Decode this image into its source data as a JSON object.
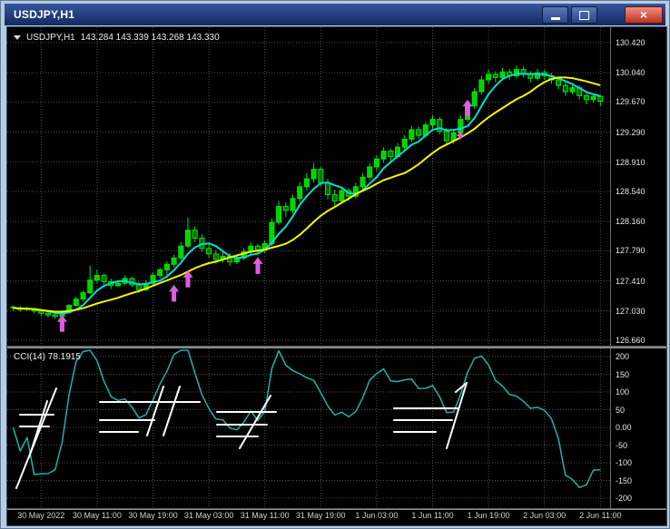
{
  "window": {
    "title": "USDJPY,H1"
  },
  "icons": {
    "close": "×"
  },
  "chart": {
    "symbol": "USDJPY,H1",
    "quote": "143.284 143.339 143.268 143.330"
  },
  "indicator": {
    "label": "CCI(14) 78.1915"
  },
  "axes": {
    "price_ticks": [
      "130.420",
      "130.040",
      "129.670",
      "129.290",
      "128.910",
      "128.540",
      "128.160",
      "127.790",
      "127.410",
      "127.030",
      "126.660"
    ],
    "cci_ticks": [
      "200",
      "150",
      "100",
      "50",
      "0.00",
      "-50",
      "-100",
      "-150",
      "-200"
    ],
    "time_ticks": [
      {
        "label": "30 May 2022",
        "bar": 4
      },
      {
        "label": "30 May 11:00",
        "bar": 12
      },
      {
        "label": "30 May 19:00",
        "bar": 20
      },
      {
        "label": "31 May 03:00",
        "bar": 28
      },
      {
        "label": "31 May 11:00",
        "bar": 36
      },
      {
        "label": "31 May 19:00",
        "bar": 44
      },
      {
        "label": "1 Jun 03:00",
        "bar": 52
      },
      {
        "label": "1 Jun 11:00",
        "bar": 60
      },
      {
        "label": "1 Jun 19:00",
        "bar": 68
      },
      {
        "label": "2 Jun 03:00",
        "bar": 76
      },
      {
        "label": "2 Jun 11:00",
        "bar": 84
      }
    ]
  },
  "colors": {
    "background": "#000000",
    "grid": "#4d4d4d",
    "candle_outline": "#00e600",
    "bull": "#00d400",
    "bear": "#007000",
    "axis_text": "#e6e6e6"
  },
  "chart_data": {
    "type": "candlestick",
    "symbol": "USDJPY",
    "timeframe": "H1",
    "price_range": [
      126.66,
      130.42
    ],
    "candles": [
      [
        127.08,
        127.1,
        127.03,
        127.07
      ],
      [
        127.07,
        127.09,
        127.02,
        127.05
      ],
      [
        127.05,
        127.08,
        127.03,
        127.06
      ],
      [
        127.06,
        127.07,
        127.0,
        127.03
      ],
      [
        127.03,
        127.05,
        126.97,
        127.0
      ],
      [
        127.0,
        127.02,
        126.95,
        126.98
      ],
      [
        126.98,
        127.0,
        126.93,
        126.96
      ],
      [
        126.96,
        127.04,
        126.94,
        127.02
      ],
      [
        127.02,
        127.12,
        127.0,
        127.1
      ],
      [
        127.1,
        127.21,
        127.08,
        127.18
      ],
      [
        127.18,
        127.29,
        127.15,
        127.26
      ],
      [
        127.26,
        127.6,
        127.24,
        127.42
      ],
      [
        127.42,
        127.55,
        127.38,
        127.48
      ],
      [
        127.48,
        127.5,
        127.36,
        127.4
      ],
      [
        127.4,
        127.44,
        127.31,
        127.35
      ],
      [
        127.35,
        127.42,
        127.33,
        127.38
      ],
      [
        127.38,
        127.48,
        127.35,
        127.44
      ],
      [
        127.44,
        127.46,
        127.33,
        127.36
      ],
      [
        127.36,
        127.4,
        127.26,
        127.3
      ],
      [
        127.3,
        127.42,
        127.28,
        127.38
      ],
      [
        127.38,
        127.52,
        127.36,
        127.48
      ],
      [
        127.48,
        127.58,
        127.44,
        127.55
      ],
      [
        127.55,
        127.66,
        127.45,
        127.62
      ],
      [
        127.62,
        127.74,
        127.58,
        127.7
      ],
      [
        127.7,
        127.9,
        127.66,
        127.85
      ],
      [
        127.85,
        128.21,
        127.82,
        128.05
      ],
      [
        128.05,
        128.1,
        127.9,
        127.95
      ],
      [
        127.95,
        128.0,
        127.78,
        127.82
      ],
      [
        127.82,
        127.88,
        127.7,
        127.75
      ],
      [
        127.75,
        127.8,
        127.63,
        127.68
      ],
      [
        127.68,
        127.78,
        127.64,
        127.72
      ],
      [
        127.72,
        127.76,
        127.6,
        127.65
      ],
      [
        127.65,
        127.74,
        127.62,
        127.7
      ],
      [
        127.7,
        127.82,
        127.67,
        127.78
      ],
      [
        127.78,
        127.9,
        127.74,
        127.85
      ],
      [
        127.85,
        127.88,
        127.73,
        127.8
      ],
      [
        127.8,
        127.92,
        127.76,
        127.88
      ],
      [
        127.88,
        128.2,
        127.85,
        128.15
      ],
      [
        128.15,
        128.42,
        128.12,
        128.35
      ],
      [
        128.35,
        128.4,
        128.22,
        128.3
      ],
      [
        128.3,
        128.5,
        128.26,
        128.45
      ],
      [
        128.45,
        128.66,
        128.4,
        128.6
      ],
      [
        128.6,
        128.77,
        128.55,
        128.7
      ],
      [
        128.7,
        128.9,
        128.65,
        128.82
      ],
      [
        128.82,
        128.85,
        128.6,
        128.65
      ],
      [
        128.65,
        128.7,
        128.44,
        128.5
      ],
      [
        128.5,
        128.56,
        128.36,
        128.42
      ],
      [
        128.42,
        128.6,
        128.4,
        128.55
      ],
      [
        128.55,
        128.58,
        128.42,
        128.48
      ],
      [
        128.48,
        128.65,
        128.45,
        128.6
      ],
      [
        128.6,
        128.77,
        128.56,
        128.72
      ],
      [
        128.72,
        128.9,
        128.68,
        128.85
      ],
      [
        128.85,
        129.0,
        128.8,
        128.95
      ],
      [
        128.95,
        129.1,
        128.9,
        129.05
      ],
      [
        129.05,
        129.08,
        128.92,
        128.98
      ],
      [
        128.98,
        129.15,
        128.95,
        129.1
      ],
      [
        129.1,
        129.25,
        129.06,
        129.2
      ],
      [
        129.2,
        129.37,
        129.16,
        129.32
      ],
      [
        129.32,
        129.36,
        129.2,
        129.25
      ],
      [
        129.25,
        129.42,
        129.22,
        129.38
      ],
      [
        129.38,
        129.5,
        129.34,
        129.45
      ],
      [
        129.45,
        129.48,
        129.26,
        129.3
      ],
      [
        129.3,
        129.34,
        129.12,
        129.18
      ],
      [
        129.18,
        129.32,
        129.14,
        129.28
      ],
      [
        129.28,
        129.5,
        129.24,
        129.45
      ],
      [
        129.45,
        129.68,
        129.42,
        129.62
      ],
      [
        129.62,
        129.85,
        129.58,
        129.8
      ],
      [
        129.8,
        130.0,
        129.76,
        129.95
      ],
      [
        129.95,
        130.08,
        129.9,
        130.02
      ],
      [
        130.02,
        130.06,
        129.92,
        129.98
      ],
      [
        129.98,
        130.1,
        129.95,
        130.05
      ],
      [
        130.05,
        130.09,
        129.95,
        130.0
      ],
      [
        130.0,
        130.13,
        129.97,
        130.08
      ],
      [
        130.08,
        130.12,
        129.98,
        130.02
      ],
      [
        130.02,
        130.06,
        129.92,
        129.97
      ],
      [
        129.97,
        130.09,
        129.94,
        130.04
      ],
      [
        130.04,
        130.08,
        129.95,
        130.0
      ],
      [
        130.0,
        130.04,
        129.9,
        129.95
      ],
      [
        129.95,
        129.99,
        129.83,
        129.88
      ],
      [
        129.88,
        129.92,
        129.75,
        129.8
      ],
      [
        129.8,
        129.89,
        129.77,
        129.85
      ],
      [
        129.85,
        129.88,
        129.7,
        129.75
      ],
      [
        129.75,
        129.8,
        129.64,
        129.7
      ],
      [
        129.7,
        129.78,
        129.66,
        129.74
      ],
      [
        129.74,
        129.76,
        129.62,
        129.68
      ]
    ],
    "ma_fast": {
      "period": 5,
      "color": "#00dcdc"
    },
    "ma_slow": {
      "period": 13,
      "color": "#f5f500"
    },
    "cci": {
      "period": 14,
      "color": "#20b2aa",
      "range": [
        -200,
        200
      ]
    },
    "signals": {
      "color": "#e05ce0",
      "arrows": [
        {
          "bar": 7,
          "price": 126.98
        },
        {
          "bar": 23,
          "price": 127.36
        },
        {
          "bar": 25,
          "price": 127.54
        },
        {
          "bar": 35,
          "price": 127.71
        },
        {
          "bar": 65,
          "price": 129.7
        }
      ],
      "star": {
        "bar": 64,
        "price": 129.25
      }
    },
    "annotations": {
      "color": "#ffffff",
      "segments": [
        [
          14,
          73,
          51,
          73
        ],
        [
          14,
          86,
          46,
          86
        ],
        [
          54,
          44,
          10,
          154
        ],
        [
          44,
          58,
          24,
          120
        ],
        [
          102,
          59,
          212,
          59
        ],
        [
          102,
          79,
          162,
          79
        ],
        [
          102,
          92,
          144,
          92
        ],
        [
          154,
          96,
          172,
          42
        ],
        [
          172,
          96,
          190,
          42
        ],
        [
          231,
          70,
          296,
          70
        ],
        [
          231,
          84,
          286,
          84
        ],
        [
          231,
          97,
          276,
          97
        ],
        [
          256,
          110,
          290,
          52
        ],
        [
          426,
          66,
          496,
          66
        ],
        [
          426,
          79,
          490,
          79
        ],
        [
          426,
          92,
          472,
          92
        ],
        [
          484,
          110,
          506,
          38
        ],
        [
          506,
          38,
          494,
          48
        ]
      ]
    }
  }
}
